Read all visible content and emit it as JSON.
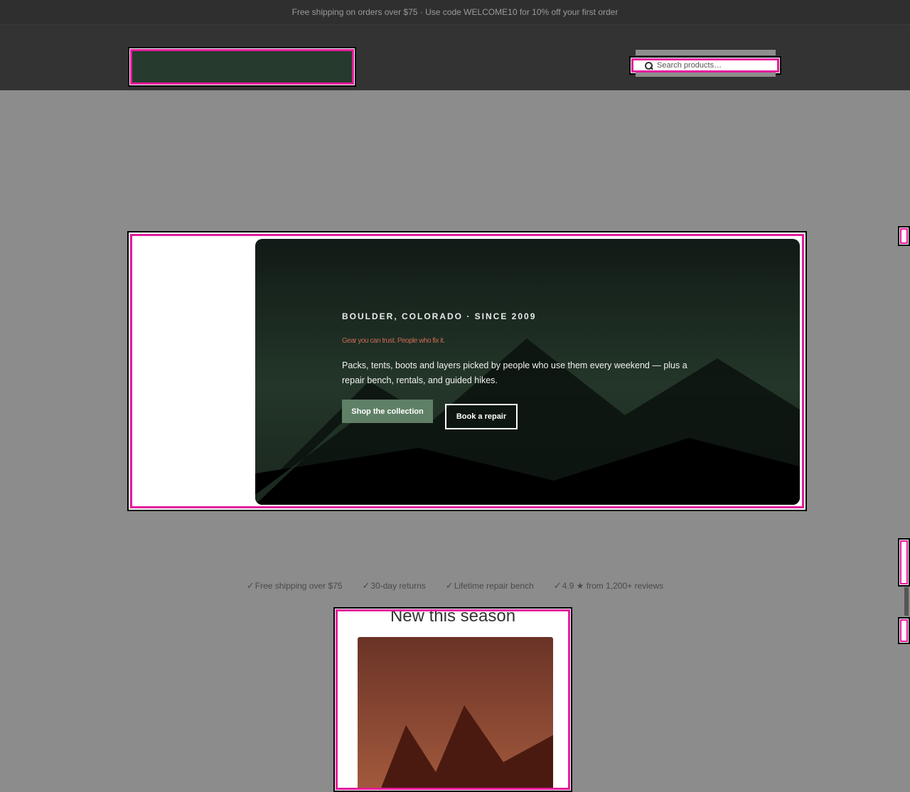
{
  "announcement": {
    "text": "Free shipping on orders over $75 · Use code WELCOME10 for 10% off your first order"
  },
  "search": {
    "placeholder": "Search products…"
  },
  "hero": {
    "eyebrow": "BOULDER, COLORADO · SINCE 2009",
    "tagline": "Gear you can trust. People who fix it.",
    "description": "Packs, tents, boots and layers picked by people who use them every weekend — plus a repair bench, rentals, and guided hikes.",
    "primary_cta": "Shop the collection",
    "secondary_cta": "Book a repair"
  },
  "trust": {
    "items": [
      {
        "check": "✓",
        "label": "Free shipping over $75"
      },
      {
        "check": "✓",
        "label": "30-day returns"
      },
      {
        "check": "✓",
        "label": "Lifetime repair bench"
      },
      {
        "check": "✓",
        "label": "4.9 ★ from 1,200+ reviews"
      }
    ]
  },
  "new_section": {
    "title": "New this season"
  },
  "colors": {
    "highlight": "#e51c9c",
    "header_bg": "#333333",
    "brand_green": "#5f8066",
    "logo_green": "#263a2e"
  }
}
